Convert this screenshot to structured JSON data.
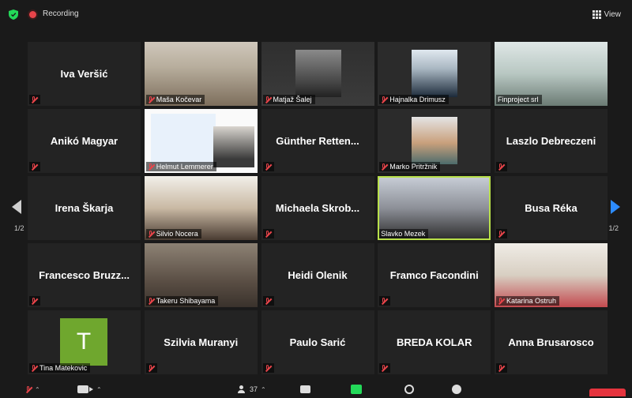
{
  "window": {
    "recording_label": "Recording",
    "view_label": "View"
  },
  "navigation": {
    "page_left": "1/2",
    "page_right": "1/2"
  },
  "participants": [
    {
      "name": "Iva Veršić",
      "video": false
    },
    {
      "name": "Maša Kočevar",
      "video": true
    },
    {
      "name": "Matjaž Šalej",
      "video": true
    },
    {
      "name": "Hajnalka Drimusz",
      "video": true
    },
    {
      "name": "Finproject srl",
      "video": true
    },
    {
      "name": "Anikó Magyar",
      "video": false
    },
    {
      "name": "Helmut Lemmerer",
      "video": true
    },
    {
      "name": "Günther Retten...",
      "video": false
    },
    {
      "name": "Marko Pritržnik",
      "video": true
    },
    {
      "name": "Laszlo Debreczeni",
      "video": false
    },
    {
      "name": "Irena Škarja",
      "video": false
    },
    {
      "name": "Silvio Nocera",
      "video": true
    },
    {
      "name": "Michaela Skrob...",
      "video": false
    },
    {
      "name": "Slavko Mezek",
      "video": true,
      "active_speaker": true
    },
    {
      "name": "Busa Réka",
      "video": false
    },
    {
      "name": "Francesco Bruzz...",
      "video": false
    },
    {
      "name": "Takeru Shibayama",
      "video": true
    },
    {
      "name": "Heidi Olenik",
      "video": false
    },
    {
      "name": "Framco Facondini",
      "video": false
    },
    {
      "name": "Katarina Ostruh",
      "video": true
    },
    {
      "name": "Tina Matekovic",
      "video": false,
      "avatar_letter": "T"
    },
    {
      "name": "Szilvia Muranyi",
      "video": false
    },
    {
      "name": "Paulo Sarić",
      "video": false
    },
    {
      "name": "BREDA KOLAR",
      "video": false
    },
    {
      "name": "Anna Brusarosco",
      "video": false
    }
  ],
  "toolbar": {
    "participants_count": "37"
  },
  "colors": {
    "active_speaker_border": "#b8e04a",
    "muted_mic": "#e8444a",
    "share_button": "#23d959",
    "end_button": "#e5343e",
    "page_arrow_right": "#2d8cff"
  }
}
